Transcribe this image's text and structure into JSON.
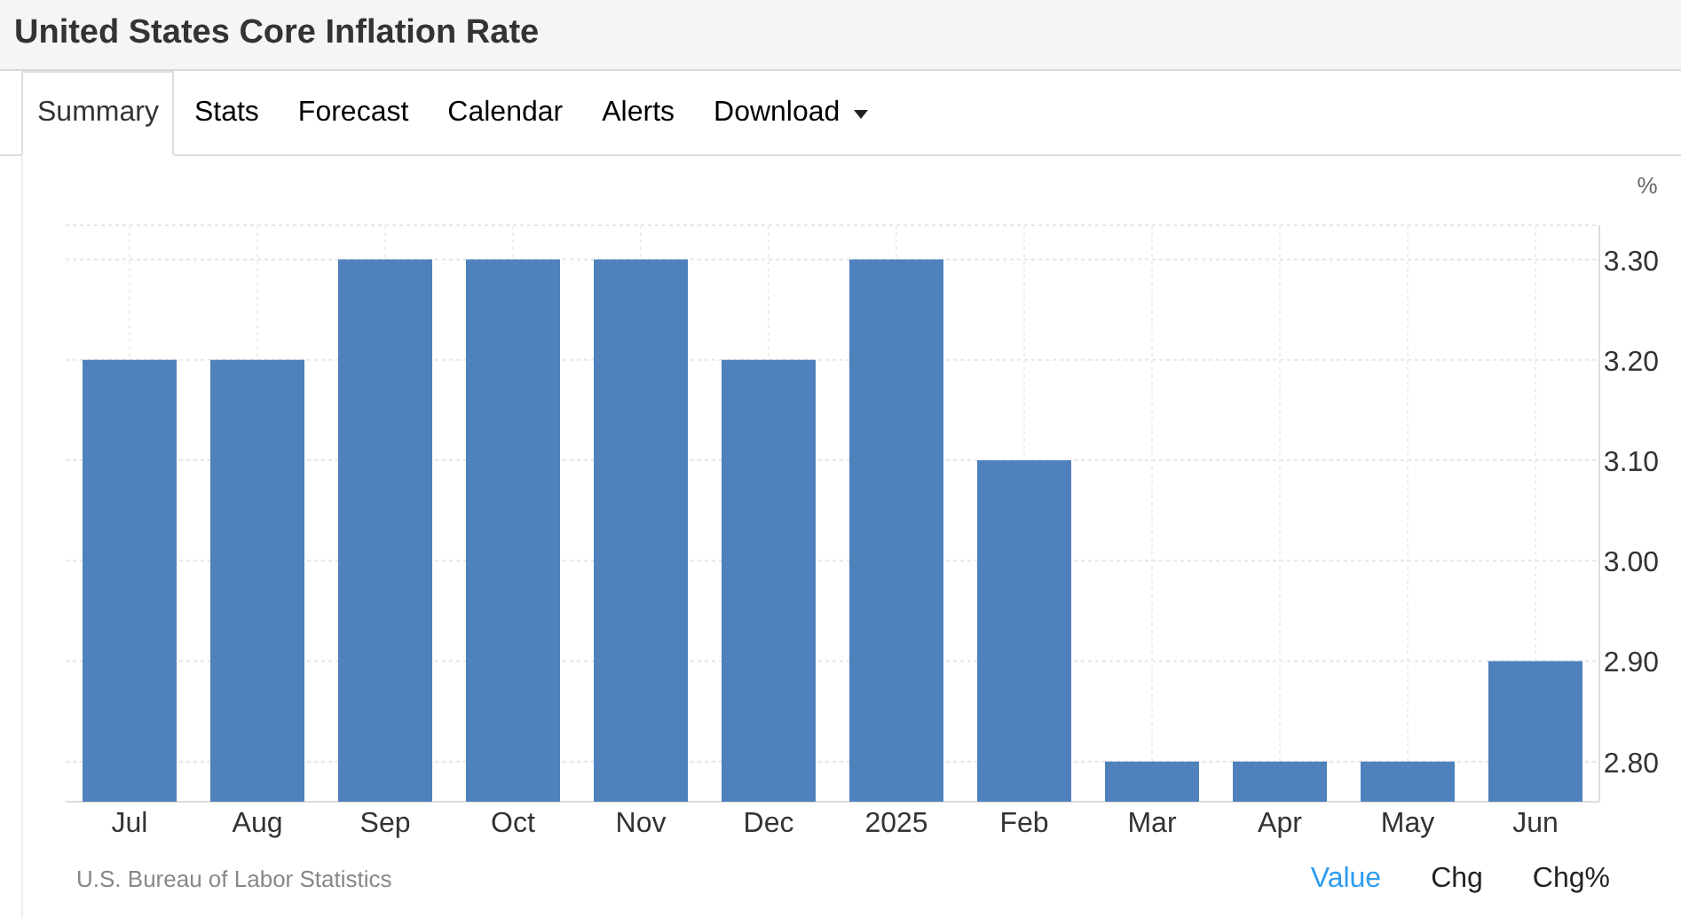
{
  "title": "United States Core Inflation Rate",
  "tabs": [
    {
      "label": "Summary",
      "selected": true
    },
    {
      "label": "Stats",
      "selected": false
    },
    {
      "label": "Forecast",
      "selected": false
    },
    {
      "label": "Calendar",
      "selected": false
    },
    {
      "label": "Alerts",
      "selected": false
    },
    {
      "label": "Download",
      "selected": false,
      "kind": "dropdown"
    }
  ],
  "chart": {
    "chart_data": {
      "type": "bar",
      "ylabel": "%",
      "categories": [
        "Jul",
        "Aug",
        "Sep",
        "Oct",
        "Nov",
        "Dec",
        "2025",
        "Feb",
        "Mar",
        "Apr",
        "May",
        "Jun"
      ],
      "grid": true,
      "series": [
        {
          "color": "#4f81bd",
          "values": [
            3.2,
            3.2,
            3.3,
            3.3,
            3.3,
            3.2,
            3.3,
            3.1,
            2.8,
            2.8,
            2.8,
            2.9
          ]
        }
      ],
      "ylim": [
        2.76,
        3.334
      ],
      "yticks": [
        {
          "value": 2.8,
          "label": "2.80"
        },
        {
          "value": 2.9,
          "label": "2.90"
        },
        {
          "value": 3.0,
          "label": "3.00"
        },
        {
          "value": 3.1,
          "label": "3.10"
        },
        {
          "value": 3.2,
          "label": "3.20"
        },
        {
          "value": 3.3,
          "label": "3.30"
        }
      ]
    }
  },
  "source": "U.S. Bureau of Labor Statistics",
  "modes": [
    {
      "label": "Value",
      "selected": true
    },
    {
      "label": "Chg",
      "selected": false
    },
    {
      "label": "Chg%",
      "selected": false
    }
  ]
}
